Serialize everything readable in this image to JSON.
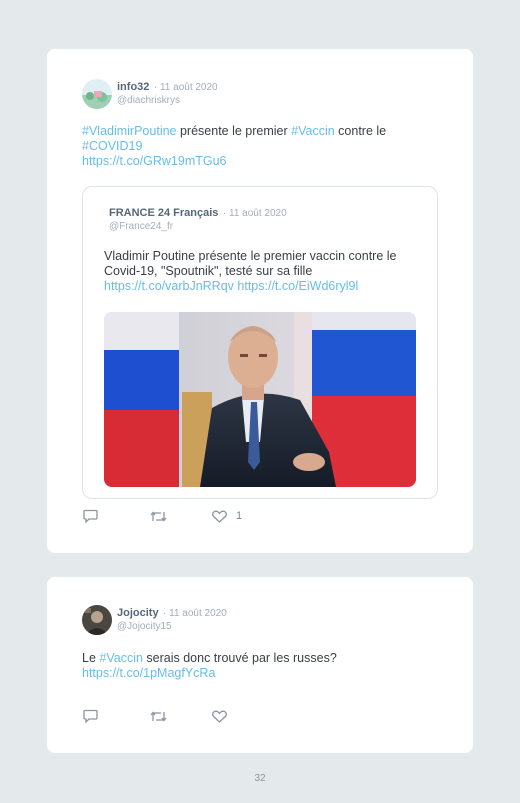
{
  "tweets": [
    {
      "author": "info32",
      "date": "11 août 2020",
      "handle": "@diachriskrys",
      "body": {
        "tag1": "#VladimirPoutine",
        "t1": " présente le premier ",
        "tag2": "#Vaccin",
        "t2": " contre le",
        "tag3": "#COVID19",
        "link": "https://t.co/GRw19mTGu6"
      },
      "quote": {
        "author": "FRANCE 24 Français",
        "date": "11 août 2020",
        "handle": "@France24_fr",
        "line1": "Vladimir Poutine présente le premier vaccin contre le",
        "line2": "Covid-19, \"Spoutnik\", testé sur sa fille",
        "link1": "https://t.co/varbJnRRqv",
        "link2": "https://t.co/EiWd6ryl9l",
        "image_icon": "photo-of-man-with-flag"
      },
      "likes": "1"
    },
    {
      "author": "Jojocity",
      "date": "11 août 2020",
      "handle": "@Jojocity15",
      "body": {
        "t1": "Le ",
        "tag1": "#Vaccin",
        "t2": " serais donc trouvé par les russes?",
        "link": "https://t.co/1pMagfYcRa"
      },
      "likes": ""
    }
  ],
  "icons": {
    "reply": "reply-icon",
    "retweet": "retweet-icon",
    "like": "heart-icon"
  },
  "colors": {
    "link": "#67bde8",
    "background": "#e4e9ec",
    "card": "#ffffff"
  },
  "page_number": "32"
}
